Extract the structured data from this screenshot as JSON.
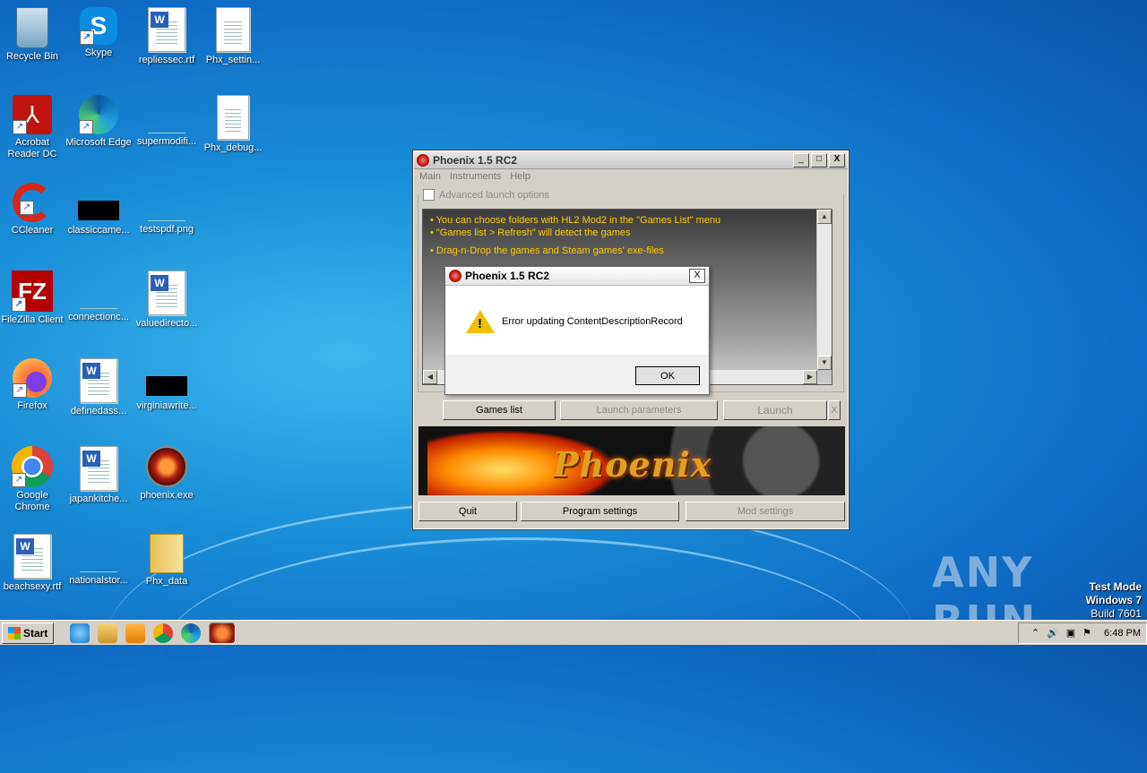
{
  "desktop": {
    "icons": [
      {
        "label": "Recycle Bin"
      },
      {
        "label": "Skype"
      },
      {
        "label": "repliessec.rtf"
      },
      {
        "label": "Phx_settin..."
      },
      {
        "label": "Acrobat Reader DC"
      },
      {
        "label": "Microsoft Edge"
      },
      {
        "label": "supermodifi..."
      },
      {
        "label": "Phx_debug..."
      },
      {
        "label": "CCleaner"
      },
      {
        "label": "classiccame..."
      },
      {
        "label": "testspdf.png"
      },
      {
        "label": "FileZilla Client"
      },
      {
        "label": "connectionc..."
      },
      {
        "label": "valuedirecto..."
      },
      {
        "label": "Firefox"
      },
      {
        "label": "definedass..."
      },
      {
        "label": "virginiawrite..."
      },
      {
        "label": "Google Chrome"
      },
      {
        "label": "japankitche..."
      },
      {
        "label": "phoenix.exe"
      },
      {
        "label": "beachsexy.rtf"
      },
      {
        "label": "nationalstor..."
      },
      {
        "label": "Phx_data"
      }
    ]
  },
  "main_window": {
    "title": "Phoenix 1.5 RC2",
    "caption_buttons": {
      "minimize": "_",
      "maximize": "□",
      "close": "X"
    },
    "menu": [
      "Main",
      "Instruments",
      "Help"
    ],
    "advanced_launch_label": "Advanced launch options",
    "info_lines": [
      "• You can choose folders with HL2 Mod2 in the \"Games List\" menu",
      "• \"Games list > Refresh\" will detect the games",
      "• Drag-n-Drop the games and Steam games' exe-files"
    ],
    "buttons": {
      "games_list": "Games list",
      "launch_parameters": "Launch parameters",
      "launch": "Launch",
      "launch_x": "X",
      "quit": "Quit",
      "program_settings": "Program settings",
      "mod_settings": "Mod settings"
    },
    "banner_text": "Phoenix"
  },
  "dialog": {
    "title": "Phoenix 1.5 RC2",
    "message": "Error updating ContentDescriptionRecord",
    "ok_label": "OK",
    "close_label": "X"
  },
  "watermark": {
    "brand": "ANY RUN",
    "line1": "Test Mode",
    "line2": "Windows 7",
    "line3": "Build 7601"
  },
  "taskbar": {
    "start_label": "Start",
    "clock": "6:48 PM"
  }
}
